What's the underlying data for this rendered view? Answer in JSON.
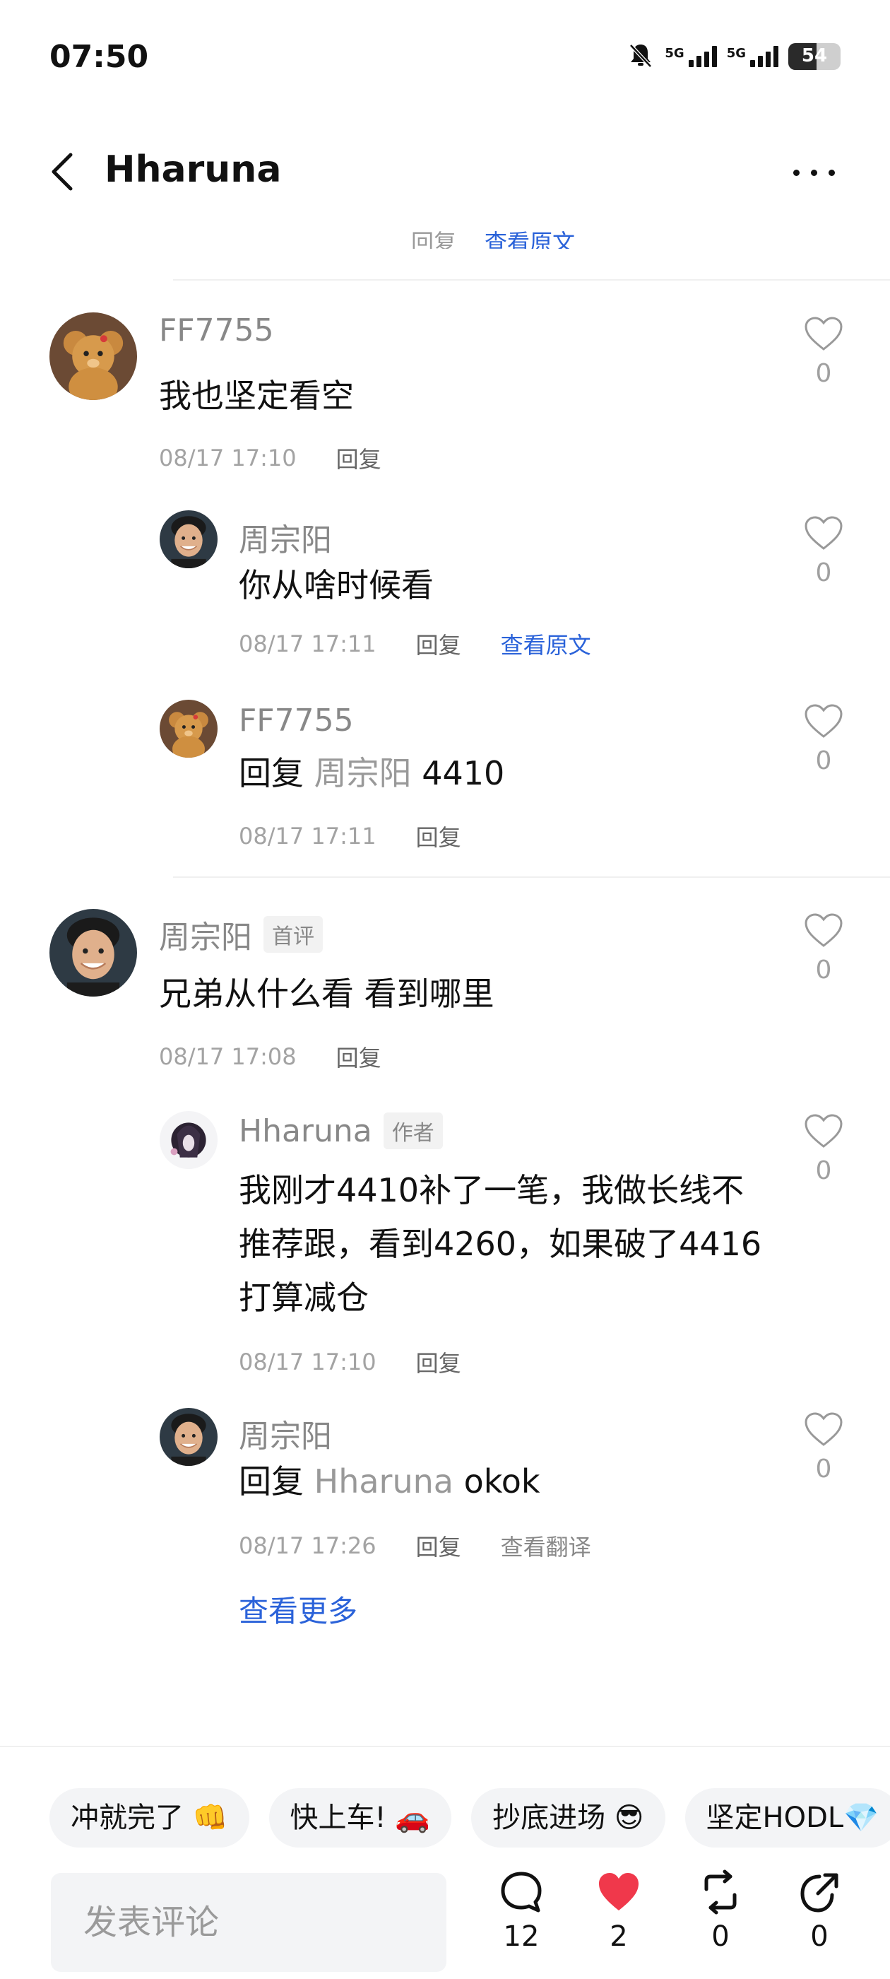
{
  "status_bar": {
    "time": "07:50",
    "network_label": "5G",
    "battery": "54",
    "battery_level": 0.54,
    "icons": [
      "bell-muted-icon",
      "signal-5g-icon",
      "signal-5g-icon",
      "battery-icon"
    ]
  },
  "header": {
    "title": "Hharuna",
    "back_icon": "back-arrow-icon",
    "more_icon": "more-dots-icon"
  },
  "partial_row": {
    "reply_label": "回复",
    "link_label": "查看原文"
  },
  "comments": [
    {
      "name": "FF7755",
      "text": "我也坚定看空",
      "time": "08/17 17:10",
      "reply_label": "回复",
      "likes": "0",
      "replies": [
        {
          "name": "周宗阳",
          "text": "你从啥时候看",
          "time": "08/17 17:11",
          "reply_label": "回复",
          "extra_link": "查看原文",
          "likes": "0"
        },
        {
          "name": "FF7755",
          "reply_prefix": "回复",
          "mention": "周宗阳",
          "text": "4410",
          "time": "08/17 17:11",
          "reply_label": "回复",
          "likes": "0"
        }
      ]
    },
    {
      "name": "周宗阳",
      "badge": "首评",
      "text": "兄弟从什么看 看到哪里",
      "time": "08/17 17:08",
      "reply_label": "回复",
      "likes": "0",
      "replies": [
        {
          "name": "Hharuna",
          "badge": "作者",
          "text_lines": [
            "我刚才4410补了一笔，我做长线不",
            "推荐跟，看到4260，如果破了4416",
            "打算减仓"
          ],
          "time": "08/17 17:10",
          "reply_label": "回复",
          "likes": "0"
        },
        {
          "name": "周宗阳",
          "reply_prefix": "回复",
          "mention": "Hharuna",
          "text": "okok",
          "time": "08/17 17:26",
          "reply_label": "回复",
          "extra_link": "查看翻译",
          "likes": "0"
        }
      ],
      "more_label": "查看更多"
    }
  ],
  "quick_replies": [
    "冲就完了 👊",
    "快上车! 🚗",
    "抄底进场 😎",
    "坚定HODL💎"
  ],
  "composer": {
    "placeholder": "发表评论"
  },
  "actions": [
    {
      "icon": "comment-icon",
      "count": "12"
    },
    {
      "icon": "heart-filled-icon",
      "count": "2"
    },
    {
      "icon": "repost-icon",
      "count": "0"
    },
    {
      "icon": "share-icon",
      "count": "0"
    }
  ],
  "colors": {
    "link": "#2a62d9",
    "like_active": "#f0384b",
    "muted_text": "#999999"
  }
}
